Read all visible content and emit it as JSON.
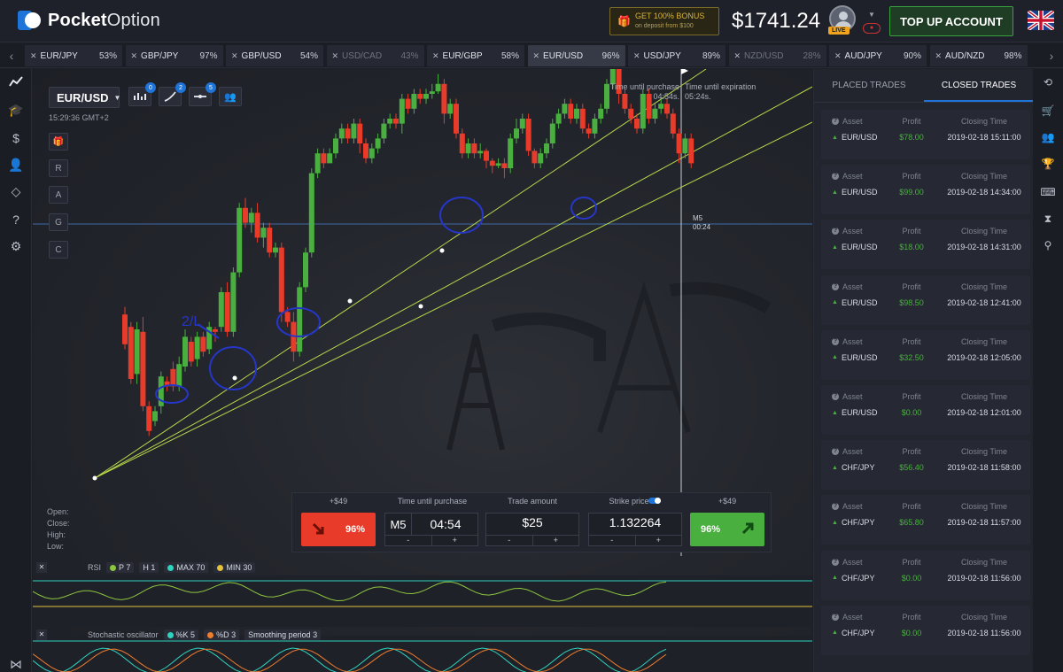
{
  "header": {
    "logo_bold": "Pocket",
    "logo_thin": "Option",
    "bonus_line1": "GET 100% BONUS",
    "bonus_line2": "on deposit from $100",
    "balance": "$1741.24",
    "live_badge": "LIVE",
    "topup_label": "TOP UP ACCOUNT"
  },
  "asset_tabs": [
    {
      "name": "EUR/JPY",
      "pct": "53%",
      "state": "normal"
    },
    {
      "name": "GBP/JPY",
      "pct": "97%",
      "state": "normal"
    },
    {
      "name": "GBP/USD",
      "pct": "54%",
      "state": "normal"
    },
    {
      "name": "USD/CAD",
      "pct": "43%",
      "state": "dim"
    },
    {
      "name": "EUR/GBP",
      "pct": "58%",
      "state": "normal"
    },
    {
      "name": "EUR/USD",
      "pct": "96%",
      "state": "active"
    },
    {
      "name": "USD/JPY",
      "pct": "89%",
      "state": "normal"
    },
    {
      "name": "NZD/USD",
      "pct": "28%",
      "state": "dim"
    },
    {
      "name": "AUD/JPY",
      "pct": "90%",
      "state": "normal"
    },
    {
      "name": "AUD/NZD",
      "pct": "98%",
      "state": "normal"
    }
  ],
  "chart": {
    "pair": "EUR/USD",
    "clock": "15:29:36 GMT+2",
    "tool_badges": [
      "0",
      "2",
      "5"
    ],
    "side_buttons": [
      "R",
      "A",
      "G",
      "C"
    ],
    "time_until_purchase_label": "Time until purchase",
    "time_until_purchase_value": "04:54s.",
    "time_until_expiration_label": "Time until expiration",
    "time_until_expiration_value": "05:24s.",
    "ms_label": "M5",
    "ms_value": "00:24",
    "ohlc": [
      "Open:",
      "Close:",
      "High:",
      "Low:"
    ],
    "annotation": "2/L",
    "candles": [
      [
        5,
        -5.5,
        0.5,
        -7,
        1.5
      ],
      [
        6,
        -3,
        7.5,
        -4,
        8.5
      ],
      [
        7,
        6.5,
        -2.5,
        8.5,
        -4
      ],
      [
        8,
        -2,
        13,
        -5,
        14
      ],
      [
        9,
        13,
        18,
        12,
        19
      ],
      [
        10,
        16,
        14,
        17,
        13
      ],
      [
        11,
        13,
        7,
        14.5,
        6
      ],
      [
        12,
        8,
        9,
        7,
        10
      ],
      [
        13,
        5.5,
        9,
        4,
        10
      ],
      [
        14,
        9,
        4.5,
        10,
        3
      ],
      [
        15,
        5,
        -1,
        6,
        -2.5
      ],
      [
        16,
        0,
        4,
        -1,
        5
      ],
      [
        17,
        3.5,
        -1,
        5,
        -2
      ],
      [
        18,
        -1,
        2,
        -2,
        3
      ],
      [
        19,
        1.5,
        -3,
        2.5,
        -4
      ],
      [
        20,
        -2.5,
        -2,
        -3,
        0
      ],
      [
        21,
        -3,
        -10,
        -2,
        -11
      ],
      [
        22,
        -10,
        -2,
        -12,
        -1
      ],
      [
        23,
        -2,
        -14,
        -1,
        -15
      ],
      [
        24,
        -14,
        -27,
        -13,
        -28
      ],
      [
        25,
        -27,
        -24,
        -29,
        -23
      ],
      [
        26,
        -24,
        -26,
        -22,
        -27
      ],
      [
        27,
        -26,
        -21,
        -28,
        -20
      ],
      [
        28,
        -21,
        -23,
        -19,
        -24
      ],
      [
        29,
        -23,
        -18,
        -24,
        -17
      ],
      [
        30,
        -18,
        -19,
        -17,
        -20
      ],
      [
        31,
        -19,
        -6,
        -20,
        -4
      ],
      [
        32,
        -6,
        -4,
        -7,
        -3
      ],
      [
        33,
        -4,
        2,
        -6,
        4
      ],
      [
        34,
        2,
        -11,
        3,
        -12
      ],
      [
        35,
        -11,
        -18,
        -10,
        -19
      ],
      [
        36,
        -18,
        -34,
        -17,
        -35
      ],
      [
        37,
        -34,
        -38,
        -33,
        -39
      ],
      [
        38,
        -38,
        -36,
        -39,
        -35
      ],
      [
        39,
        -36,
        -38,
        -37,
        -39
      ],
      [
        40,
        -38,
        -41,
        -37,
        -42
      ],
      [
        41,
        -41,
        -43,
        -40,
        -44
      ],
      [
        42,
        -43,
        -41,
        -44,
        -40
      ],
      [
        43,
        -41,
        -44,
        -40,
        -45
      ],
      [
        44,
        -44,
        -40,
        -45,
        -38
      ],
      [
        45,
        -40,
        -37,
        -41,
        -36
      ],
      [
        46,
        -37,
        -39,
        -36,
        -40
      ],
      [
        47,
        -39,
        -41,
        -38,
        -42
      ],
      [
        48,
        -41,
        -44,
        -40,
        -45
      ],
      [
        49,
        -44,
        -45,
        -43,
        -46
      ],
      [
        50,
        -45,
        -44,
        -46,
        -43
      ],
      [
        51,
        -44,
        -49,
        -42,
        -50
      ],
      [
        52,
        -49,
        -47,
        -50,
        -46
      ],
      [
        53,
        -47,
        -50,
        -46,
        -51
      ],
      [
        54,
        -50,
        -49,
        -51,
        -48
      ],
      [
        55,
        -49,
        -50,
        -48,
        -51
      ],
      [
        56,
        -50,
        -50.5,
        -49,
        -52
      ],
      [
        57,
        -50.5,
        -52,
        -50,
        -54
      ],
      [
        58,
        -52,
        -46,
        -53,
        -44
      ],
      [
        59,
        -46,
        -48,
        -45,
        -49
      ],
      [
        60,
        -48,
        -42,
        -49,
        -41
      ],
      [
        61,
        -42,
        -38,
        -43,
        -37
      ],
      [
        62,
        -38,
        -40,
        -37,
        -41
      ],
      [
        63,
        -40,
        -38,
        -41,
        -37
      ],
      [
        64,
        -38,
        -38.5,
        -37,
        -40
      ],
      [
        65,
        -38.5,
        -36.5,
        -39,
        -35
      ],
      [
        66,
        -36.5,
        -35.5,
        -37,
        -34
      ],
      [
        67,
        -35.5,
        -36,
        -35,
        -37
      ],
      [
        68,
        -36,
        -35,
        -37,
        -33
      ],
      [
        69,
        -35,
        -41,
        -34,
        -42
      ],
      [
        70,
        -41,
        -43,
        -40,
        -45
      ],
      [
        71,
        -43,
        -45,
        -42,
        -46
      ],
      [
        72,
        -45,
        -38.5,
        -46,
        -37.5
      ],
      [
        73,
        -38.5,
        -36,
        -39,
        -35
      ],
      [
        74,
        -36,
        -38,
        -35,
        -39
      ],
      [
        75,
        -38,
        -40,
        -37,
        -41
      ],
      [
        76,
        -40,
        -44,
        -39,
        -45
      ],
      [
        77,
        -44,
        -46,
        -43,
        -47
      ],
      [
        78,
        -46,
        -48,
        -45,
        -49
      ],
      [
        79,
        -48,
        -45,
        -49,
        -44
      ],
      [
        80,
        -45,
        -47,
        -44,
        -48
      ],
      [
        81,
        -47,
        -43,
        -48,
        -42
      ],
      [
        82,
        -43,
        -42,
        -44,
        -41
      ],
      [
        83,
        -42,
        -45,
        -41,
        -46
      ],
      [
        84,
        -45,
        -47,
        -44,
        -48
      ],
      [
        85,
        -47,
        -52,
        -46,
        -53
      ],
      [
        86,
        -52,
        -56,
        -51,
        -57
      ],
      [
        87,
        -56,
        -50,
        -57,
        -48
      ],
      [
        88,
        -50,
        -47,
        -51,
        -46
      ],
      [
        89,
        -47,
        -45,
        -48,
        -44
      ],
      [
        90,
        -45,
        -43,
        -46,
        -42
      ],
      [
        91,
        -43,
        -50,
        -42,
        -51
      ],
      [
        92,
        -50,
        -45,
        -51,
        -44
      ],
      [
        93,
        -45,
        -47,
        -44,
        -48
      ],
      [
        94,
        -47,
        -48,
        -46,
        -49
      ],
      [
        95,
        -48,
        -46,
        -49,
        -45
      ],
      [
        96,
        -46,
        -42,
        -47,
        -41
      ],
      [
        97,
        -42,
        -38,
        -43,
        -36
      ],
      [
        98,
        -38,
        -41,
        -37,
        -42
      ],
      [
        99,
        -41,
        -36,
        -42,
        -35
      ]
    ]
  },
  "trade_panel": {
    "put_payout": "+$49",
    "call_payout": "+$49",
    "put_pct": "96%",
    "call_pct": "96%",
    "time_label": "Time until purchase",
    "timeframe": "M5",
    "time_value": "04:54",
    "amount_label": "Trade amount",
    "amount_value": "$25",
    "strike_label": "Strike price",
    "strike_value": "1.132264",
    "minus": "-",
    "plus": "+"
  },
  "indicators": {
    "rsi_label": "RSI",
    "rsi_params": [
      "P 7",
      "H 1",
      "MAX 70",
      "MIN 30"
    ],
    "stoch_label": "Stochastic oscillator",
    "stoch_params": [
      "%K 5",
      "%D 3",
      "Smoothing period 3"
    ],
    "colors": {
      "green": "#8cc63f",
      "cyan": "#2dd4bf",
      "yellow": "#e3c23a",
      "orange": "#ef7d2e"
    }
  },
  "right_panel": {
    "tab_placed": "PLACED TRADES",
    "tab_closed": "CLOSED TRADES",
    "col_asset": "Asset",
    "col_profit": "Profit",
    "col_time": "Closing Time",
    "trades": [
      {
        "asset": "EUR/USD",
        "profit": "$78.00",
        "time": "2019-02-18 15:11:00"
      },
      {
        "asset": "EUR/USD",
        "profit": "$99.00",
        "time": "2019-02-18 14:34:00"
      },
      {
        "asset": "EUR/USD",
        "profit": "$18.00",
        "time": "2019-02-18 14:31:00"
      },
      {
        "asset": "EUR/USD",
        "profit": "$98.50",
        "time": "2019-02-18 12:41:00"
      },
      {
        "asset": "EUR/USD",
        "profit": "$32.50",
        "time": "2019-02-18 12:05:00"
      },
      {
        "asset": "EUR/USD",
        "profit": "$0.00",
        "time": "2019-02-18 12:01:00"
      },
      {
        "asset": "CHF/JPY",
        "profit": "$56.40",
        "time": "2019-02-18 11:58:00"
      },
      {
        "asset": "CHF/JPY",
        "profit": "$65.80",
        "time": "2019-02-18 11:57:00"
      },
      {
        "asset": "CHF/JPY",
        "profit": "$0.00",
        "time": "2019-02-18 11:56:00"
      },
      {
        "asset": "CHF/JPY",
        "profit": "$0.00",
        "time": "2019-02-18 11:56:00"
      }
    ]
  },
  "colors": {
    "up": "#49b03f",
    "down": "#e93b2a",
    "accent": "#1e74d8",
    "trend": "#b7d84b"
  }
}
